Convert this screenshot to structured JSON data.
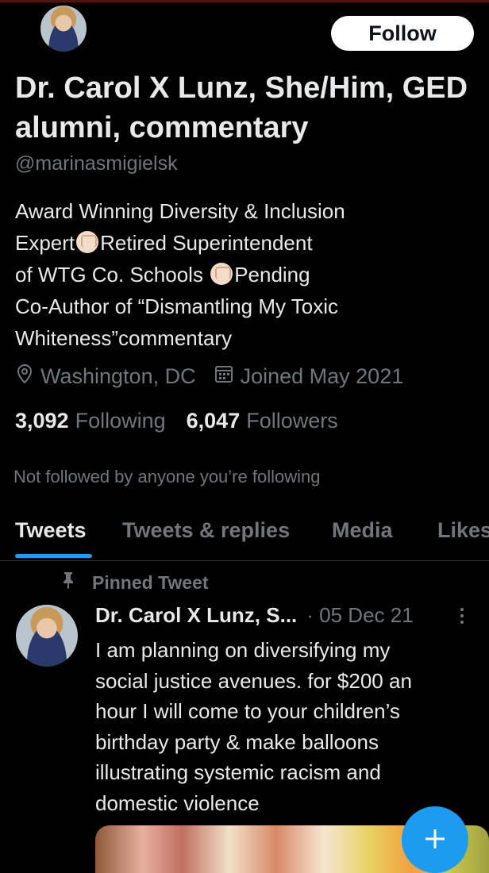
{
  "profile": {
    "name": "Dr. Carol X Lunz, She/Him, GED alumni, commentary",
    "handle": "@marinasmigielsk",
    "bio_lines": [
      {
        "before": "Award Winning Diversity & Inclusion",
        "after": ""
      },
      {
        "before": "Expert",
        "after": "Retired Superintendent"
      },
      {
        "before": "of WTG Co. Schools ",
        "after": "Pending"
      },
      {
        "before": "Co-Author of “Dismantling My Toxic",
        "after": ""
      },
      {
        "before": "Whiteness”commentary",
        "after": ""
      }
    ],
    "location": "Washington, DC",
    "joined": "Joined May 2021",
    "following_count": "3,092",
    "following_label": "Following",
    "followers_count": "6,047",
    "followers_label": "Followers",
    "not_followed_text": "Not followed by anyone you’re following"
  },
  "follow_button": {
    "label": "Follow"
  },
  "tabs": [
    {
      "label": "Tweets",
      "active": true
    },
    {
      "label": "Tweets & replies",
      "active": false
    },
    {
      "label": "Media",
      "active": false
    },
    {
      "label": "Likes",
      "active": false
    }
  ],
  "pinned_tweet": {
    "pinned_label": "Pinned Tweet",
    "author": "Dr. Carol X Lunz, S...",
    "date": "· 05 Dec 21",
    "text_lines": [
      "I am planning on diversifying my",
      "social justice avenues. for $200 an",
      "hour I will come to your children’s",
      "birthday party & make balloons",
      "illustrating systemic racism and",
      "domestic violence"
    ]
  },
  "icons": {
    "location": "location-pin-icon",
    "calendar": "calendar-icon",
    "pin": "pin-icon",
    "more": "more-vertical-icon",
    "compose": "plus-icon",
    "fist": "raised-fist-emoji"
  },
  "colors": {
    "background": "#000000",
    "text": "#e7e9ea",
    "muted": "#71767b",
    "accent": "#1d9bf0"
  }
}
